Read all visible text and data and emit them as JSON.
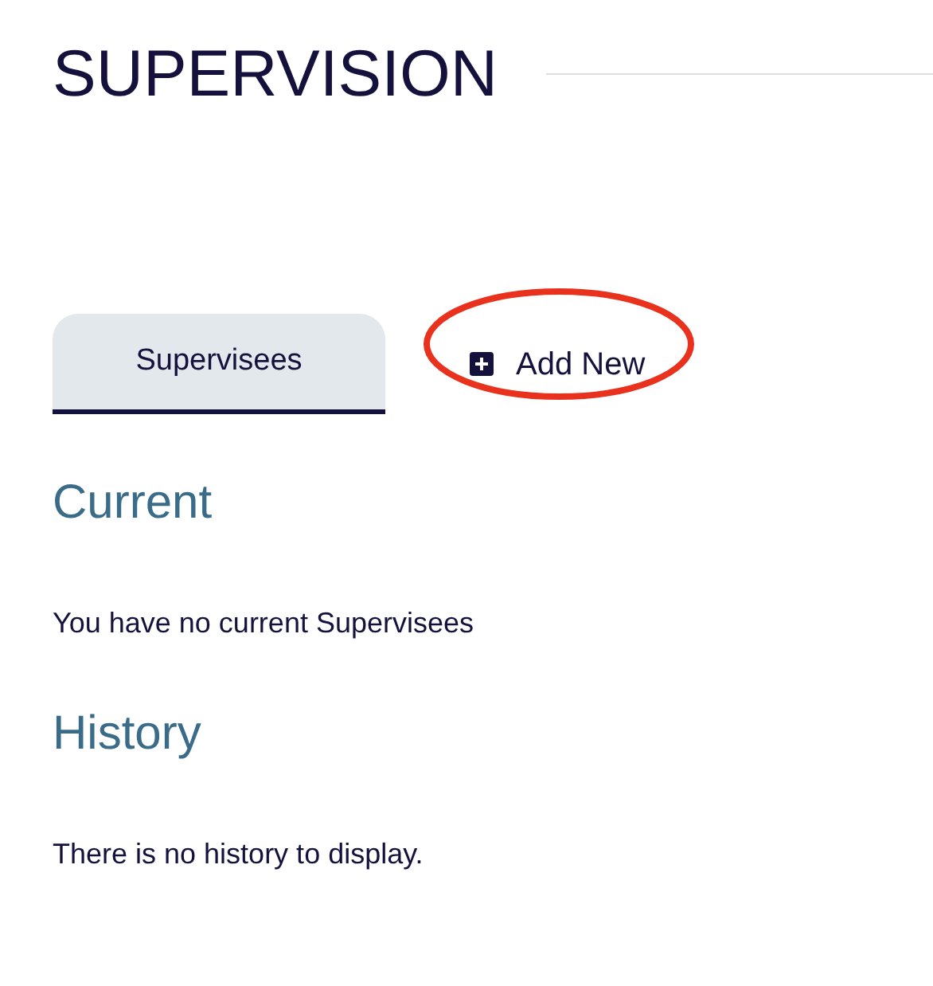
{
  "page_title": "SUPERVISION",
  "tabs": [
    {
      "label": "Supervisees",
      "selected": true
    }
  ],
  "add_button": {
    "label": "Add New",
    "highlighted": true
  },
  "sections": [
    {
      "heading": "Current",
      "text": "You have no current Supervisees"
    },
    {
      "heading": "History",
      "text": "There is no history to display."
    }
  ]
}
